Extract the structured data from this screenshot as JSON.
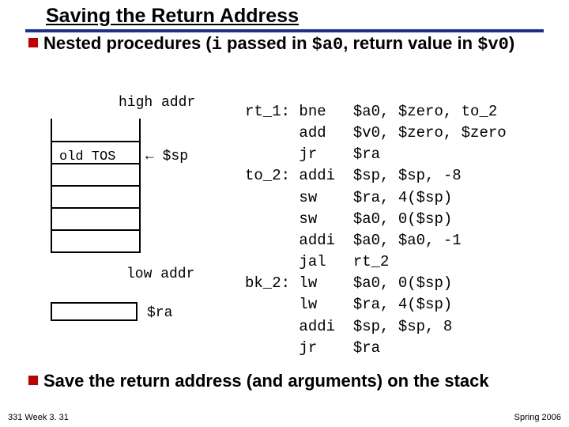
{
  "title": "Saving the Return Address",
  "bullet1_pre": "Nested procedures (",
  "bullet1_i": "i",
  "bullet1_mid1": " passed in ",
  "bullet1_a0": "$a0",
  "bullet1_mid2": ", return value in ",
  "bullet1_v0": "$v0",
  "bullet1_end": ")",
  "bullet2": "Save the return address (and arguments) on the stack",
  "stack": {
    "high": "high addr",
    "low": "low addr",
    "old_tos": "old TOS",
    "sp": "← $sp",
    "ra": "$ra"
  },
  "asm": "rt_1: bne   $a0, $zero, to_2\n      add   $v0, $zero, $zero\n      jr    $ra\nto_2: addi  $sp, $sp, -8\n      sw    $ra, 4($sp)\n      sw    $a0, 0($sp)\n      addi  $a0, $a0, -1\n      jal   rt_2\nbk_2: lw    $a0, 0($sp)\n      lw    $ra, 4($sp)\n      addi  $sp, $sp, 8\n      jr    $ra",
  "footer_left": "331 Week 3. 31",
  "footer_right": "Spring 2006"
}
